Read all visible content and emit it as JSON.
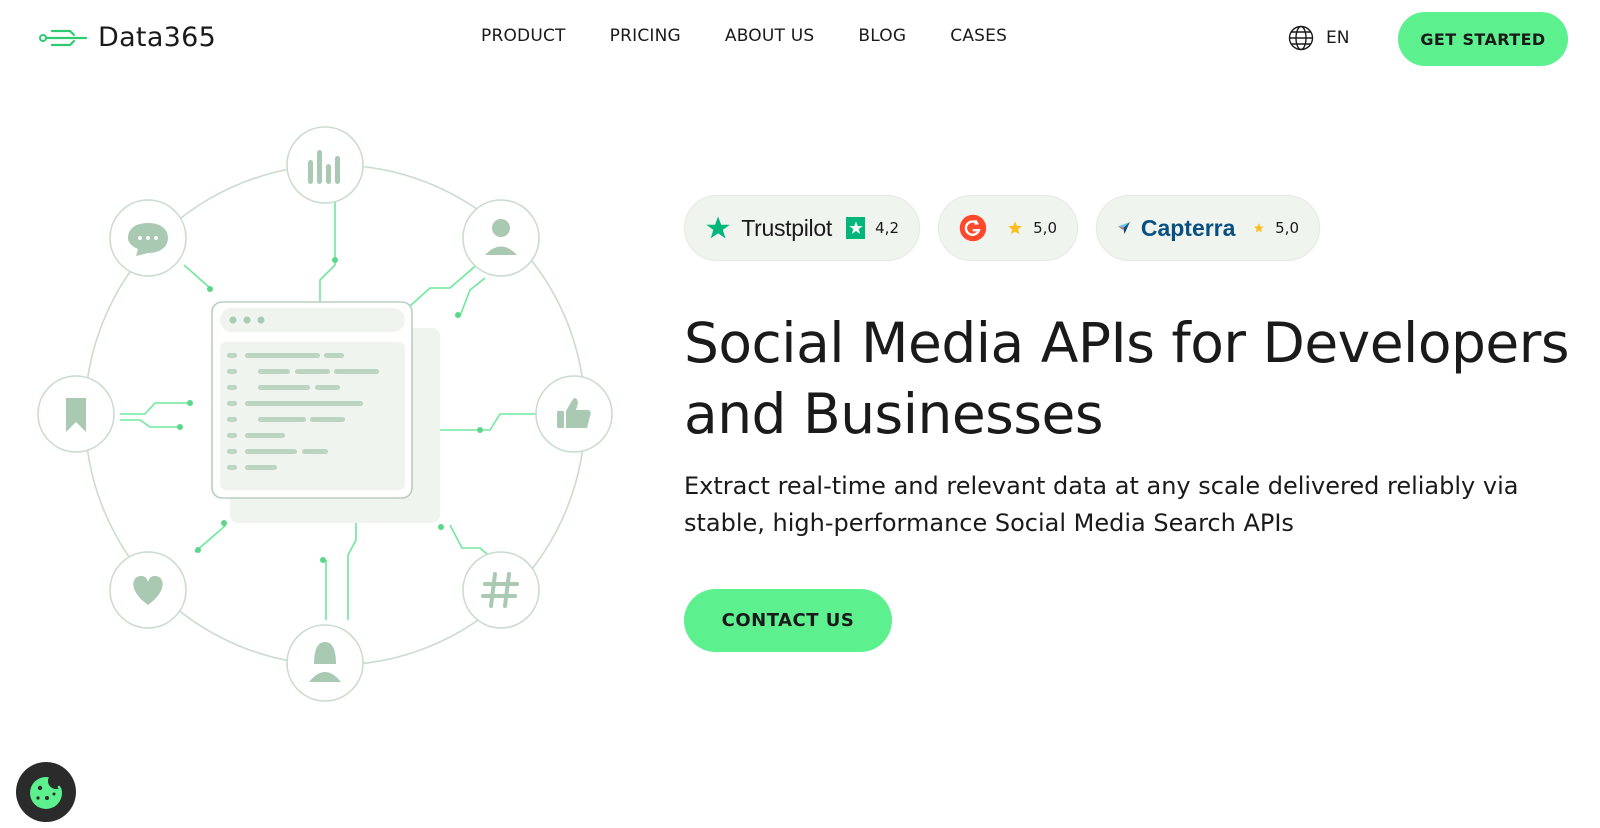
{
  "brand": {
    "name": "Data365",
    "accent": "#5cf08f",
    "logo_icon": "circuit-lines-icon"
  },
  "nav": {
    "items": [
      "PRODUCT",
      "PRICING",
      "ABOUT US",
      "BLOG",
      "CASES"
    ]
  },
  "language": {
    "icon": "globe-icon",
    "label": "EN"
  },
  "header_cta": "GET STARTED",
  "badges": {
    "trustpilot": {
      "name": "Trustpilot",
      "score": "4,2",
      "icon": "trustpilot-star-icon"
    },
    "g2": {
      "score": "5,0",
      "icon": "g2-logo-icon"
    },
    "capterra": {
      "name": "Capterra",
      "score": "5,0",
      "icon": "capterra-arrow-icon"
    }
  },
  "hero": {
    "title": "Social Media APIs for Developers and Businesses",
    "subtitle": "Extract real-time and relevant data at any scale delivered reliably via stable, high-performance Social Media Search APIs",
    "cta": "CONTACT US"
  },
  "illustration": {
    "nodes": [
      "bar-chart-icon",
      "user-icon",
      "thumbs-up-icon",
      "hashtag-icon",
      "woman-user-icon",
      "heart-icon",
      "bookmark-icon",
      "chat-bubble-icon"
    ],
    "center": "code-window-icon"
  },
  "cookie": {
    "icon": "cookie-icon"
  }
}
